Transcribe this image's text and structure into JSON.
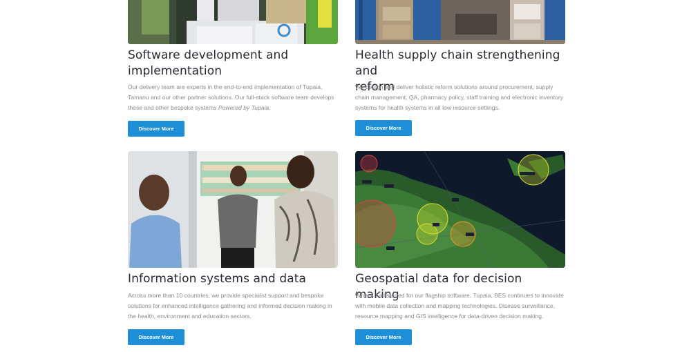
{
  "cards": [
    {
      "title_line1": "Software development and",
      "title_line2": "implementation",
      "desc_plain": "Our delivery team are experts in the end-to-end implementation of Tupaia, Tamanu and our other partner solutions. Our full-stack software team develops these and other bespoke systems ",
      "desc_italic": "Powered by Tupaia.",
      "button": "Discover More"
    },
    {
      "title_line1": "Health supply chain strengthening and",
      "title_line2": "reform",
      "desc": "We design and deliver holistic reform solutions around procurement, supply chain management, QA, pharmacy policy, staff training and electronic inventory systems for health systems in all low resource settings.",
      "button": "Discover More"
    },
    {
      "title": "Information systems and data",
      "desc": "Across more than 10 countries, we provide specialist support and bespoke solutions for enhanced intelligence gathering and informed decision making in the health, environment and education sectors.",
      "button": "Discover More"
    },
    {
      "title": "Geospatial data for decision making",
      "desc": "Where it all started for our flagship software, Tupaia, BES continues to innovate with mobile data collection and mapping technologies. Disease surveillance, resource mapping and GIS intelligence for data-driven decision making.",
      "button": "Discover More"
    }
  ],
  "colors": {
    "button": "#1e8fd6",
    "title": "#2a2a33",
    "text": "#8a8a8a"
  }
}
